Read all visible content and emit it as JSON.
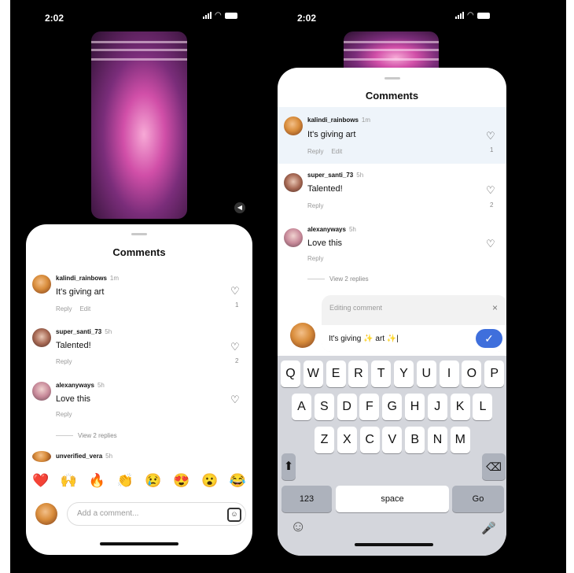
{
  "left_screen": {
    "status_time": "2:02",
    "sheet_title": "Comments",
    "comments": [
      {
        "username": "kalindi_rainbows",
        "time": "1m",
        "text": "It's giving art",
        "reply": "Reply",
        "edit": "Edit",
        "likes": "1"
      },
      {
        "username": "super_santi_73",
        "time": "5h",
        "text": "Talented!",
        "reply": "Reply",
        "likes": "2"
      },
      {
        "username": "alexanyways",
        "time": "5h",
        "text": "Love this",
        "reply": "Reply",
        "view_replies": "View 2 replies"
      },
      {
        "username": "unverified_vera",
        "time": "5h"
      }
    ],
    "emojis": [
      "❤️",
      "🙌",
      "🔥",
      "👏",
      "😢",
      "😍",
      "😮",
      "😂"
    ],
    "comment_placeholder": "Add a comment..."
  },
  "right_screen": {
    "status_time": "2:02",
    "sheet_title": "Comments",
    "comments": [
      {
        "username": "kalindi_rainbows",
        "time": "1m",
        "text": "It's giving art",
        "reply": "Reply",
        "edit": "Edit",
        "likes": "1"
      },
      {
        "username": "super_santi_73",
        "time": "5h",
        "text": "Talented!",
        "reply": "Reply",
        "likes": "2"
      },
      {
        "username": "alexanyways",
        "time": "5h",
        "text": "Love this",
        "reply": "Reply",
        "view_replies": "View 2 replies"
      }
    ],
    "editing": {
      "header": "Editing comment",
      "close": "×",
      "value": "It's giving ✨ art ✨|",
      "confirm_icon": "✓"
    },
    "keyboard": {
      "row1": [
        "Q",
        "W",
        "E",
        "R",
        "T",
        "Y",
        "U",
        "I",
        "O",
        "P"
      ],
      "row2": [
        "A",
        "S",
        "D",
        "F",
        "G",
        "H",
        "J",
        "K",
        "L"
      ],
      "row3": [
        "Z",
        "X",
        "C",
        "V",
        "B",
        "N",
        "M"
      ],
      "shift": "⬆",
      "backspace": "⌫",
      "numbers": "123",
      "space": "space",
      "go": "Go",
      "emoji": "☺",
      "mic": "🎤"
    }
  },
  "colors": {
    "accent": "#3f6fdc",
    "heart_red": "#e0243a",
    "highlight": "#eef4fa"
  }
}
